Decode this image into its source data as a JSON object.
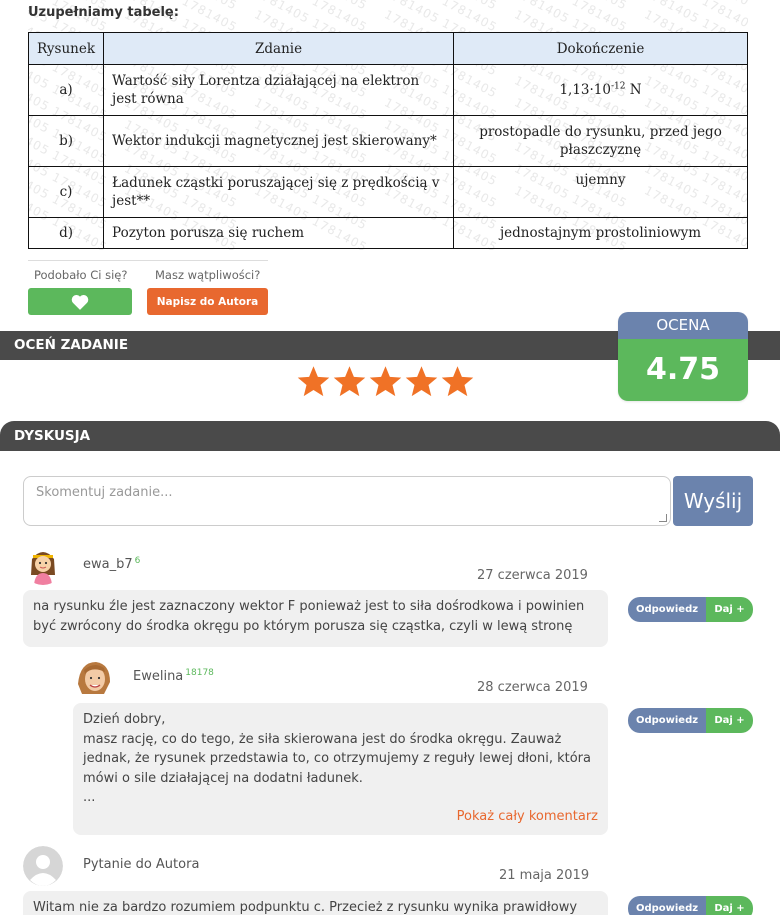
{
  "task": {
    "intro": "Uzupełniamy tabelę:",
    "watermark_text": "1781405",
    "table": {
      "headers": [
        "Rysunek",
        "Zdanie",
        "Dokończenie"
      ],
      "rows": [
        {
          "fig": "a)",
          "sentence": "Wartość siły Lorentza działającej na elektron jest równa",
          "completion_base": "1,13·10",
          "completion_exp": "-12",
          "completion_unit": " N"
        },
        {
          "fig": "b)",
          "sentence": "Wektor indukcji magnetycznej jest skierowany*",
          "completion": "prostopadle do rysunku, przed jego płaszczyznę"
        },
        {
          "fig": "c)",
          "sentence": "Ładunek cząstki poruszającej się z prędkością v jest**",
          "completion": "ujemny"
        },
        {
          "fig": "d)",
          "sentence": "Pozyton porusza się ruchem",
          "completion": "jednostajnym prostoliniowym"
        }
      ]
    }
  },
  "feedback": {
    "liked_label": "Podobało Ci się?",
    "doubt_label": "Masz wątpliwości?",
    "author_button": "Napisz do Autora"
  },
  "rating": {
    "bar_title": "OCEŃ ZADANIE",
    "stars": 5,
    "score_title": "OCENA",
    "score_value": "4.75",
    "star_color": "#f07226"
  },
  "discussion": {
    "bar_title": "DYSKUSJA",
    "comment_placeholder": "Skomentuj zadanie...",
    "send_label": "Wyślij",
    "reply_label": "Odpowiedz",
    "give_label": "Daj +",
    "comments": [
      {
        "user": "ewa_b7",
        "points": "6",
        "date": "27 czerwca 2019",
        "lines": [
          "na rysunku źle jest zaznaczony wektor F ponieważ jest to siła dośrodkowa i powinien",
          "być zwrócony do środka okręgu po którym porusza się cząstka, czyli w lewą stronę"
        ]
      },
      {
        "user": "Ewelina",
        "points": "18178",
        "date": "28 czerwca 2019",
        "lines": [
          "Dzień dobry,",
          "masz rację, co do tego, że siła skierowana jest do środka okręgu. Zauważ",
          "jednak, że rysunek przedstawia to, co otrzymujemy z reguły lewej dłoni, która",
          "mówi o sile działającej na dodatni ładunek.",
          "..."
        ],
        "more": "Pokaż cały komentarz"
      },
      {
        "user": "Pytanie do Autora",
        "date": "21 maja 2019",
        "lines": [
          "Witam nie za bardzo rozumiem podpunktu c. Przecież z rysunku wynika prawidłowy"
        ]
      }
    ]
  }
}
